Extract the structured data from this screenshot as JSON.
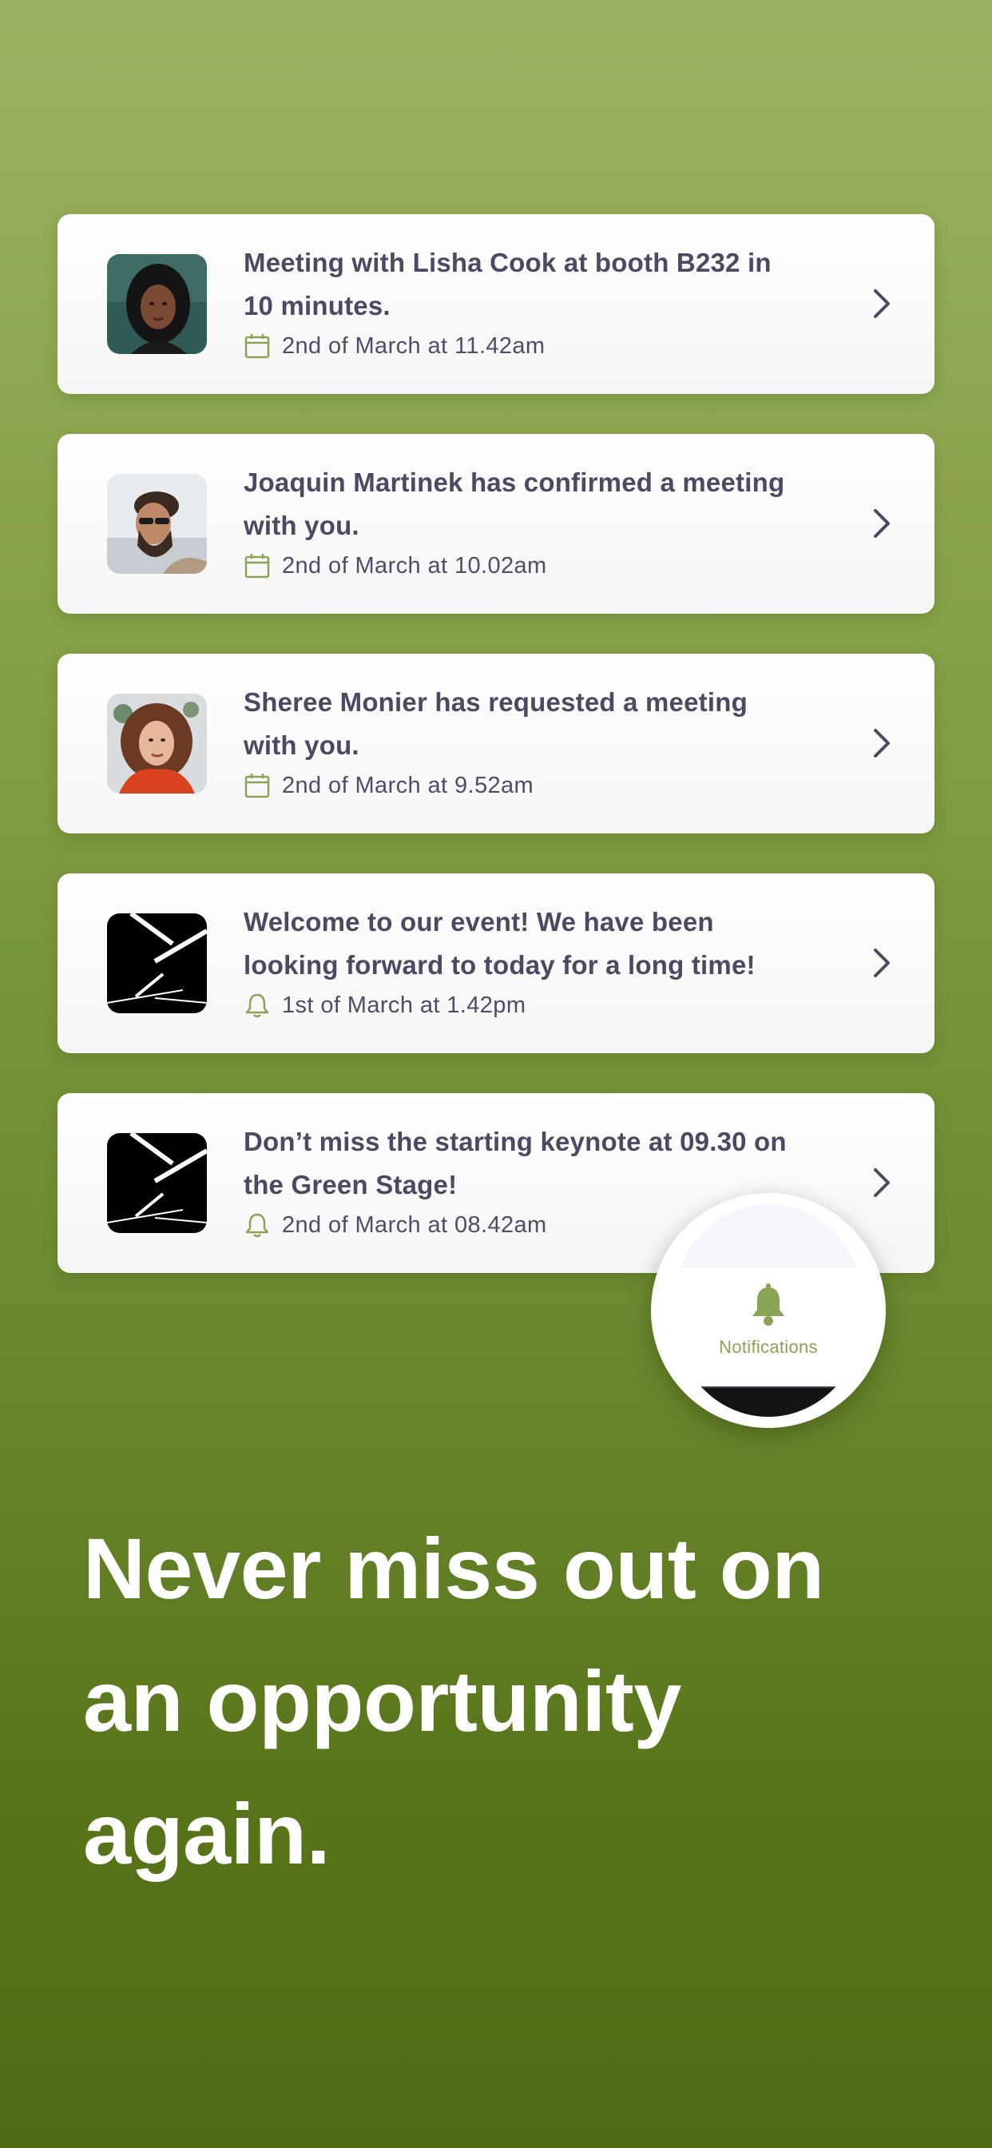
{
  "colors": {
    "accent_green": "#8aa455",
    "title_text": "#4a4a63",
    "headline_text": "#ffffff"
  },
  "notifications": [
    {
      "avatar": "woman-portrait-dark-hair",
      "title": "Meeting with Lisha Cook at booth B232 in 10 minutes.",
      "meta_icon": "calendar-icon",
      "timestamp": "2nd of March at 11.42am"
    },
    {
      "avatar": "man-portrait-beard-sunglasses",
      "title": "Joaquin Martinek has confirmed a meeting with you.",
      "meta_icon": "calendar-icon",
      "timestamp": "2nd of March at 10.02am"
    },
    {
      "avatar": "woman-portrait-curly-hair",
      "title": "Sheree Monier has requested a meeting with you.",
      "meta_icon": "calendar-icon",
      "timestamp": "2nd of March at 9.52am"
    },
    {
      "avatar": "event-logo",
      "title": "Welcome to our event! We have been looking forward to today for a long time!",
      "meta_icon": "bell-icon",
      "timestamp": "1st of March at 1.42pm"
    },
    {
      "avatar": "event-logo",
      "title": "Don’t miss the starting keynote at 09.30 on the Green Stage!",
      "meta_icon": "bell-icon",
      "timestamp": "2nd of March at 08.42am"
    }
  ],
  "tab_badge": {
    "icon": "bell-icon",
    "label": "Notifications"
  },
  "headline": "Never miss out on an opportunity again."
}
